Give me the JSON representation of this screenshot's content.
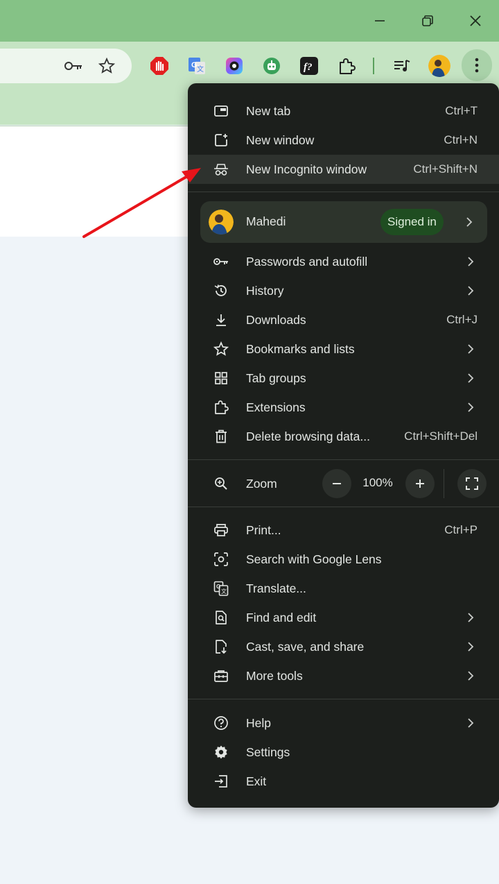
{
  "window": {
    "minimize_glyph": "—",
    "restore_glyph": "❐",
    "close_glyph": "✕"
  },
  "toolbar": {
    "icons": [
      "password-key-icon",
      "bookmark-star-icon",
      "ad-blocker-extension-icon",
      "google-translate-extension-icon",
      "screen-recorder-extension-icon",
      "bot-extension-icon",
      "font-identifier-extension-icon",
      "extensions-puzzle-icon",
      "media-control-icon",
      "profile-avatar",
      "chrome-menu-icon"
    ]
  },
  "menu": {
    "section1": [
      {
        "label": "New tab",
        "shortcut": "Ctrl+T",
        "icon": "new-tab-icon"
      },
      {
        "label": "New window",
        "shortcut": "Ctrl+N",
        "icon": "new-window-icon"
      },
      {
        "label": "New Incognito window",
        "shortcut": "Ctrl+Shift+N",
        "icon": "incognito-icon"
      }
    ],
    "profile": {
      "name": "Mahedi",
      "status": "Signed in"
    },
    "section2": [
      {
        "label": "Passwords and autofill",
        "shortcut": "",
        "icon": "key-icon"
      },
      {
        "label": "History",
        "shortcut": "",
        "icon": "history-icon"
      },
      {
        "label": "Downloads",
        "shortcut": "Ctrl+J",
        "icon": "download-icon"
      },
      {
        "label": "Bookmarks and lists",
        "shortcut": "",
        "icon": "star-icon"
      },
      {
        "label": "Tab groups",
        "shortcut": "",
        "icon": "tab-groups-icon"
      },
      {
        "label": "Extensions",
        "shortcut": "",
        "icon": "puzzle-icon"
      },
      {
        "label": "Delete browsing data...",
        "shortcut": "Ctrl+Shift+Del",
        "icon": "trash-icon"
      }
    ],
    "zoom": {
      "label": "Zoom",
      "value": "100%",
      "minus": "−",
      "plus": "+"
    },
    "section3": [
      {
        "label": "Print...",
        "shortcut": "Ctrl+P",
        "icon": "print-icon"
      },
      {
        "label": "Search with Google Lens",
        "shortcut": "",
        "icon": "lens-icon"
      },
      {
        "label": "Translate...",
        "shortcut": "",
        "icon": "translate-icon"
      },
      {
        "label": "Find and edit",
        "shortcut": "",
        "icon": "find-icon"
      },
      {
        "label": "Cast, save, and share",
        "shortcut": "",
        "icon": "cast-save-icon"
      },
      {
        "label": "More tools",
        "shortcut": "",
        "icon": "toolbox-icon"
      }
    ],
    "section4": [
      {
        "label": "Help",
        "shortcut": "",
        "icon": "help-icon"
      },
      {
        "label": "Settings",
        "shortcut": "",
        "icon": "settings-icon"
      },
      {
        "label": "Exit",
        "shortcut": "",
        "icon": "exit-icon"
      }
    ]
  },
  "annotation": {
    "arrow_color": "#e8141a"
  }
}
